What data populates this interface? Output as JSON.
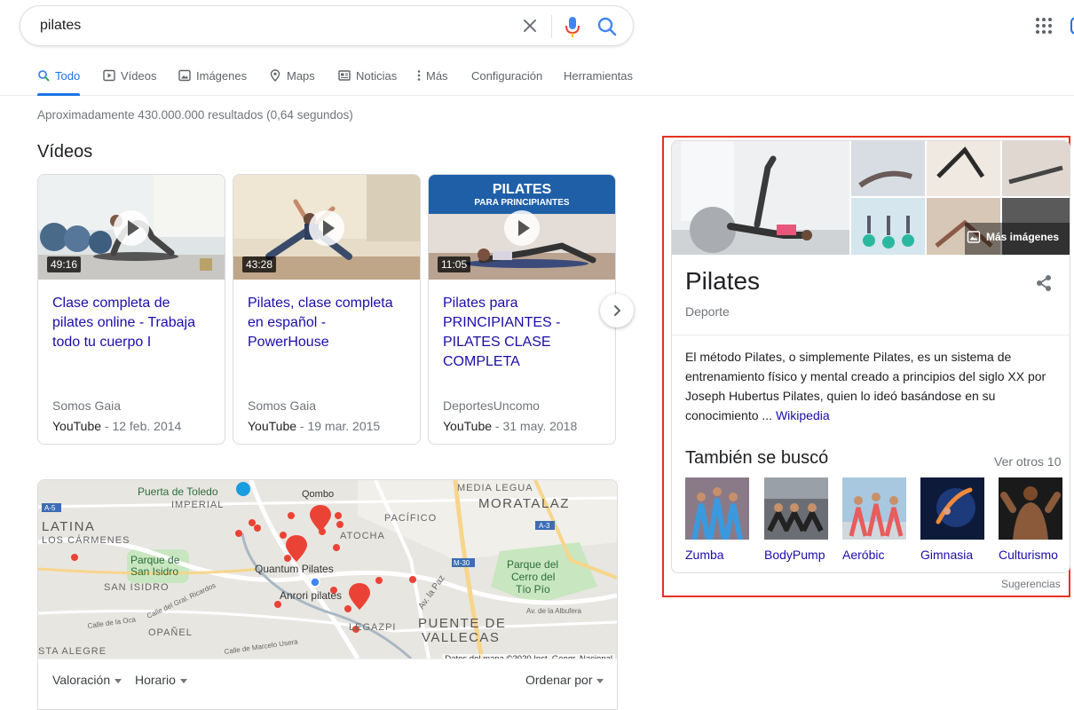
{
  "search": {
    "query": "pilates"
  },
  "tabs": [
    {
      "label": "Todo",
      "active": true
    },
    {
      "label": "Vídeos"
    },
    {
      "label": "Imágenes"
    },
    {
      "label": "Maps"
    },
    {
      "label": "Noticias"
    },
    {
      "label": "Más"
    },
    {
      "label": "Configuración"
    },
    {
      "label": "Herramientas"
    }
  ],
  "result_stats": "Aproximadamente 430.000.000 resultados (0,64 segundos)",
  "videos": {
    "title": "Vídeos",
    "items": [
      {
        "title": "Clase completa de pilates online - Trabaja todo tu cuerpo I",
        "duration": "49:16",
        "channel": "Somos Gaia",
        "platform": "YouTube",
        "date": " - 12 feb. 2014"
      },
      {
        "title": "Pilates, clase completa en español - PowerHouse",
        "duration": "43:28",
        "channel": "Somos Gaia",
        "platform": "YouTube",
        "date": " - 19 mar. 2015"
      },
      {
        "title": "Pilates para PRINCIPIANTES - PILATES CLASE COMPLETA",
        "duration": "11:05",
        "channel": "DeportesUncomo",
        "platform": "YouTube",
        "date": " - 31 may. 2018",
        "thumb_text_1": "PILATES",
        "thumb_text_2": "PARA PRINCIPIANTES"
      }
    ]
  },
  "map": {
    "labels": {
      "puerta_toledo": "Puerta de Toledo",
      "qombo": "Qombo",
      "media_legua": "MEDIA LEGUA",
      "moratalaz": "MORATALAZ",
      "imperial": "IMPERIAL",
      "pacifico": "PACÍFICO",
      "latina": "LATINA",
      "carmenes": "LOS CÁRMENES",
      "atocha": "ATOCHA",
      "parque_isidro_1": "Parque de",
      "parque_isidro_2": "San Isidro",
      "quantum": "Quantum Pilates",
      "parque_cerro_1": "Parque del",
      "parque_cerro_2": "Cerro del",
      "parque_cerro_3": "Tío Pío",
      "san_isidro": "SAN ISIDRO",
      "anrori": "Anrori pilates",
      "av_paz": "Av. la Paz",
      "av_albufera": "Av. de la Albufera",
      "puente_1": "PUENTE DE",
      "puente_2": "VALLECAS",
      "opanel": "OPAÑEL",
      "legazpi": "LEGAZPI",
      "sta_alegre": "STA ALEGRE",
      "gral_ricardos": "Calle del Gral. Ricardos",
      "oca": "Calle de la Oca",
      "marcelo": "Calle de Marcelo Usera",
      "a5": "A-5",
      "a3": "A-3",
      "m30": "M-30"
    },
    "credit": "Datos del mapa ©2020 Inst. Geogr. Nacional",
    "filters": {
      "rating": "Valoración",
      "hours": "Horario",
      "sort": "Ordenar por"
    }
  },
  "knowledge_panel": {
    "title": "Pilates",
    "subtitle": "Deporte",
    "more_images": "Más imágenes",
    "description": "El método Pilates, o simplemente Pilates, es un sistema de entrenamiento físico y mental creado a principios del siglo XX por Joseph Hubertus Pilates, quien lo ideó basándose en su conocimiento ... ",
    "source": "Wikipedia",
    "also_searched": {
      "title": "También se buscó",
      "see_more": "Ver otros 10",
      "items": [
        {
          "label": "Zumba"
        },
        {
          "label": "BodyPump"
        },
        {
          "label": "Aeróbic"
        },
        {
          "label": "Gimnasia"
        },
        {
          "label": "Culturismo"
        }
      ]
    },
    "feedback": "Sugerencias"
  },
  "colors": {
    "accent": "#1a73e8",
    "link": "#1a0dab",
    "highlight": "#e8321f",
    "map_pin": "#ea4335"
  }
}
